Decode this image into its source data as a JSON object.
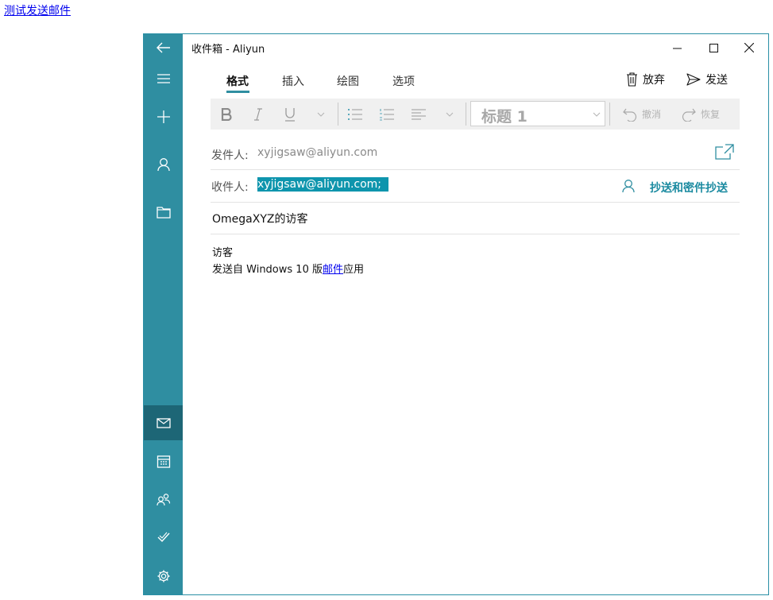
{
  "page_link": "测试发送邮件",
  "window": {
    "title": "收件箱 - Aliyun"
  },
  "rail_icons": [
    "back-arrow-icon",
    "hamburger-menu-icon",
    "plus-icon",
    "person-icon",
    "folder-icon",
    "mail-icon",
    "calendar-icon",
    "people-icon",
    "todo-icon",
    "settings-gear-icon"
  ],
  "tabs": [
    "格式",
    "插入",
    "绘图",
    "选项"
  ],
  "actions": {
    "discard": "放弃",
    "send": "发送"
  },
  "toolbar": {
    "style_value": "标题 1",
    "undo": "撤消",
    "redo": "恢复"
  },
  "from": {
    "label": "发件人:",
    "value": "xyjigsaw@aliyun.com"
  },
  "to": {
    "label": "收件人:",
    "value": "xyjigsaw@aliyun.com;",
    "cc_label": "抄送和密件抄送"
  },
  "subject": "OmegaXYZ的访客",
  "body": {
    "line1": "访客",
    "sig_prefix": "发送自 Windows 10 版",
    "sig_link": "邮件",
    "sig_suffix": "应用"
  },
  "colors": {
    "rail": "#2f8ea1",
    "rail_active": "#1d6676",
    "accent": "#1a93a8",
    "selection": "#0e95ad"
  }
}
